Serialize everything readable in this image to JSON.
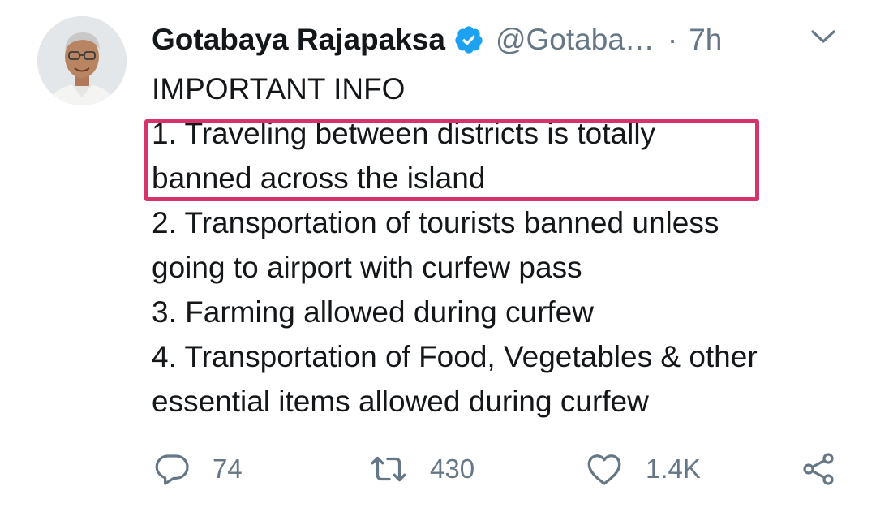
{
  "tweet": {
    "author_name": "Gotabaya Rajapaksa",
    "handle": "@Gotaba…",
    "separator": "·",
    "time": "7h",
    "lines": [
      "IMPORTANT INFO",
      "1. Traveling between districts is totally",
      "banned across the island",
      "2. Transportation of tourists banned unless",
      "going to airport with curfew pass",
      "3. Farming allowed during curfew",
      "4. Transportation of Food, Vegetables & other",
      "essential items allowed during curfew"
    ]
  },
  "actions": {
    "reply_count": "74",
    "retweet_count": "430",
    "like_count": "1.4K"
  },
  "icons": {
    "verified": "verified-badge-icon",
    "menu": "chevron-down-icon",
    "reply": "reply-icon",
    "retweet": "retweet-icon",
    "like": "heart-icon",
    "share": "share-icon"
  },
  "colors": {
    "verified": "#1da1f2",
    "muted": "#657786",
    "text": "#14171a",
    "highlight_box": "#d6336c"
  }
}
